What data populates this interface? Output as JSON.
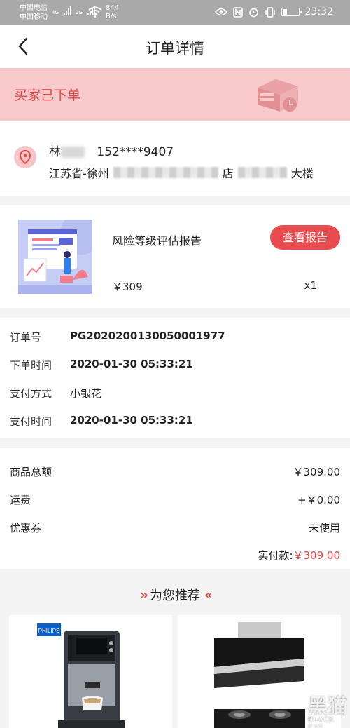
{
  "status_bar": {
    "carrier_1": "中国电信",
    "carrier_2": "中国移动",
    "sig1_tag": "4G",
    "sig2_tag": "2G",
    "speed_value": "844",
    "speed_unit": "B/s",
    "battery_level_fraction": 0.3,
    "time": "23:32",
    "icons": [
      "eye-icon",
      "nfc-icon",
      "alarm-icon",
      "vibrate-icon",
      "battery-icon"
    ]
  },
  "nav": {
    "title": "订单详情",
    "back_icon": "chevron-left-icon"
  },
  "order_status": {
    "text": "买家已下单",
    "icon": "box-clock-icon",
    "bg_color": "#f8c9cb",
    "text_color": "#e24a4a"
  },
  "address": {
    "name_visible": "林",
    "phone": "152****9407",
    "line_prefix": "江苏省-徐州",
    "line_mid": "店",
    "line_suffix": "大楼"
  },
  "product": {
    "name": "风险等级评估报告",
    "price": "￥309",
    "quantity": "x1",
    "report_button": "查看报告",
    "button_color": "#e94c4e"
  },
  "order_info": [
    {
      "label": "订单号",
      "value": "PG2020200130050001977"
    },
    {
      "label": "下单时间",
      "value": "2020-01-30 05:33:21"
    },
    {
      "label": "支付方式",
      "value": "小银花"
    },
    {
      "label": "支付时间",
      "value": "2020-01-30 05:33:21"
    }
  ],
  "amounts": {
    "goods_total_label": "商品总额",
    "goods_total_value": "￥309.00",
    "shipping_label": "运费",
    "shipping_value": "+￥0.00",
    "coupon_label": "优惠券",
    "coupon_value": "未使用",
    "paid_label": "实付款:",
    "paid_value": "￥309.00"
  },
  "recommend": {
    "title": "为您推荐",
    "left_chevrons": "»",
    "right_chevrons": "«",
    "cards": [
      {
        "brand": "PHILIPS",
        "kind": "coffee-machine"
      },
      {
        "kind": "range-hood-and-stove"
      }
    ]
  },
  "watermark": {
    "big": "黑猫",
    "small": "BLACK CAT"
  }
}
